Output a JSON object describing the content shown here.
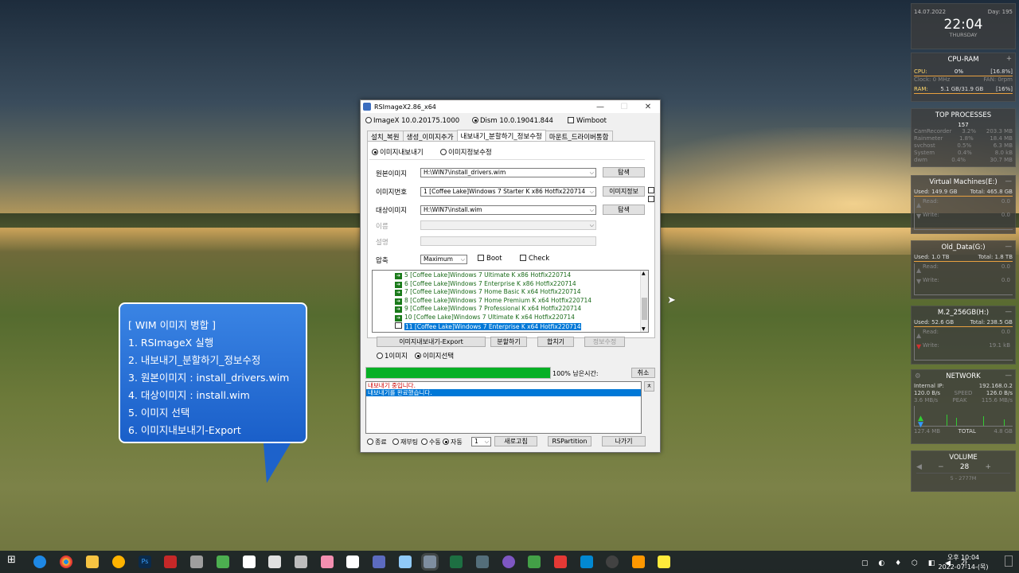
{
  "gadgets": {
    "clock": {
      "date": "14.07.2022",
      "day": "Day: 195",
      "time": "22:04",
      "weekday": "THURSDAY"
    },
    "cpu_ram": {
      "title": "CPU-RAM",
      "cpu_label": "CPU:",
      "cpu_value": "0%",
      "cpu_pct": "[16.8%]",
      "clock_label": "Clock: 0 MHz",
      "fan_label": "FAN: 0rpm",
      "ram_label": "RAM:",
      "ram_value": "5.1 GB/31.9 GB",
      "ram_pct": "[16%]"
    },
    "top_processes": {
      "title": "TOP PROCESSES",
      "count": "157",
      "rows": [
        {
          "name": "CamRecorder",
          "cpu": "3.2%",
          "mem": "203.3 MB"
        },
        {
          "name": "Rainmeter",
          "cpu": "1.8%",
          "mem": "18.4 MB"
        },
        {
          "name": "svchost",
          "cpu": "0.5%",
          "mem": "6.3 MB"
        },
        {
          "name": "System",
          "cpu": "0.4%",
          "mem": "8.0 kB"
        },
        {
          "name": "dwm",
          "cpu": "0.4%",
          "mem": "30.7 MB"
        }
      ]
    },
    "drives": [
      {
        "title": "Virtual Machines(E:)",
        "used": "Used: 149.9 GB",
        "total": "Total: 465.8 GB",
        "read": "Read:",
        "read_val": "0.0",
        "write": "Write:",
        "write_val": "0.0"
      },
      {
        "title": "Old_Data(G:)",
        "used": "Used: 1.0 TB",
        "total": "Total: 1.8 TB",
        "read": "Read:",
        "read_val": "0.0",
        "write": "Write:",
        "write_val": "0.0"
      },
      {
        "title": "M.2_256GB(H:)",
        "used": "Used: 52.6 GB",
        "total": "Total: 238.5 GB",
        "read": "Read:",
        "read_val": "0.0",
        "write": "Write:",
        "write_val": "19.1 kB"
      }
    ],
    "network": {
      "title": "NETWORK",
      "ip_label": "Internal IP:",
      "ip": "192.168.0.2",
      "down": "120.0 B/s",
      "speed": "SPEED",
      "up": "126.0 B/s",
      "down2": "3.6 MB/s",
      "peak": "PEAK",
      "up2": "115.6 MB/s",
      "total_down": "127.4 MB",
      "total": "TOTAL",
      "total_up": "4.8 GB"
    },
    "volume": {
      "title": "VOLUME",
      "minus": "−",
      "value": "28",
      "plus": "+",
      "device": "5 - 2777M"
    }
  },
  "window": {
    "title": "RSImageX2.86_x64",
    "minimize": "—",
    "maximize": "☐",
    "close": "✕",
    "engine_imagex": "ImageX 10.0.20175.1000",
    "engine_dism": "Dism 10.0.19041.844",
    "wimboot": "Wimboot",
    "tabs": [
      "설치_복원",
      "생성_이미지추가",
      "내보내기_분할하기_정보수정",
      "마운트_드라이버통합"
    ],
    "mode_export": "이미지내보내기",
    "mode_info": "이미지정보수정",
    "source_label": "원본이미지",
    "source_value": "H:\\WIN7\\install_drivers.wim",
    "browse1": "탐색",
    "index_label": "이미지번호",
    "index_value": "1  [Coffee Lake]Windows 7 Starter K x86 Hotfix220714",
    "image_info_btn": "이미지정보",
    "target_label": "대상이미지",
    "target_value": "H:\\WIN7\\install.wim",
    "browse2": "탐색",
    "name_label": "이름",
    "desc_label": "설명",
    "compress_label": "압축",
    "compress_value": "Maximum",
    "boot_label": "Boot",
    "check_label": "Check",
    "tree_items": [
      "5  [Coffee Lake]Windows 7 Ultimate K x86 Hotfix220714",
      "6  [Coffee Lake]Windows 7 Enterprise K x86 Hotfix220714",
      "7  [Coffee Lake]Windows 7 Home Basic K x64 Hotfix220714",
      "8  [Coffee Lake]Windows 7 Home Premium K x64 Hotfix220714",
      "9  [Coffee Lake]Windows 7 Professional K x64 Hotfix220714",
      "10  [Coffee Lake]Windows 7 Ultimate K x64 Hotfix220714",
      "11  [Coffee Lake]Windows 7 Enterprise K x64 Hotfix220714"
    ],
    "btn_export": "이미지내보내기-Export",
    "btn_split": "분할하기",
    "btn_merge": "합치기",
    "btn_edit": "정보수정",
    "radio_one": "1이미지",
    "radio_select": "이미지선택",
    "progress_pct": 100,
    "progress_text": "100% 남은시간:",
    "btn_cancel": "취소",
    "log_line1": "내보내기 중입니다.",
    "log_line2": "내보내기를 완료했습니다.",
    "log_btn": "ㅊ",
    "after_exit": "종료",
    "after_reboot": "재부팅",
    "after_manual": "수동",
    "after_auto": "자동",
    "count_value": "1",
    "btn_refresh": "새로고침",
    "btn_rspartition": "RSPartition",
    "btn_exit": "나가기"
  },
  "callout": {
    "lines": [
      "[ WIM 이미지 병합 ]",
      "1. RSImageX 실행",
      "2. 내보내기_분할하기_정보수정",
      "3. 원본이미지 : install_drivers.wim",
      "4. 대상이미지 : install.wim",
      "5. 이미지 선택",
      "6. 이미지내보내기-Export"
    ]
  },
  "taskbar": {
    "time": "오후 10:04",
    "date": "2022-07-14-(목)"
  },
  "colors": {
    "accent": "#0078d7",
    "progress": "#06b025",
    "callout": "#2a72d8"
  }
}
